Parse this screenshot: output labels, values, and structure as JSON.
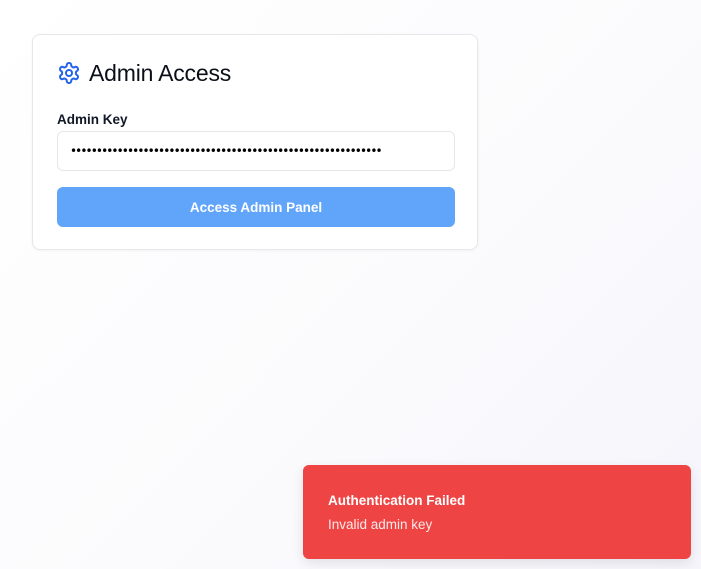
{
  "admin_card": {
    "title": "Admin Access",
    "icon": "gear-icon",
    "accent_color": "#2563eb",
    "field_label": "Admin Key",
    "key_value": "••••••••••••••••••••••••••••••••••••••••••••••••••••••••••••",
    "button_label": "Access Admin Panel",
    "button_color": "#60a5fa"
  },
  "toast": {
    "title": "Authentication Failed",
    "message": "Invalid admin key",
    "color": "#ef4444"
  }
}
